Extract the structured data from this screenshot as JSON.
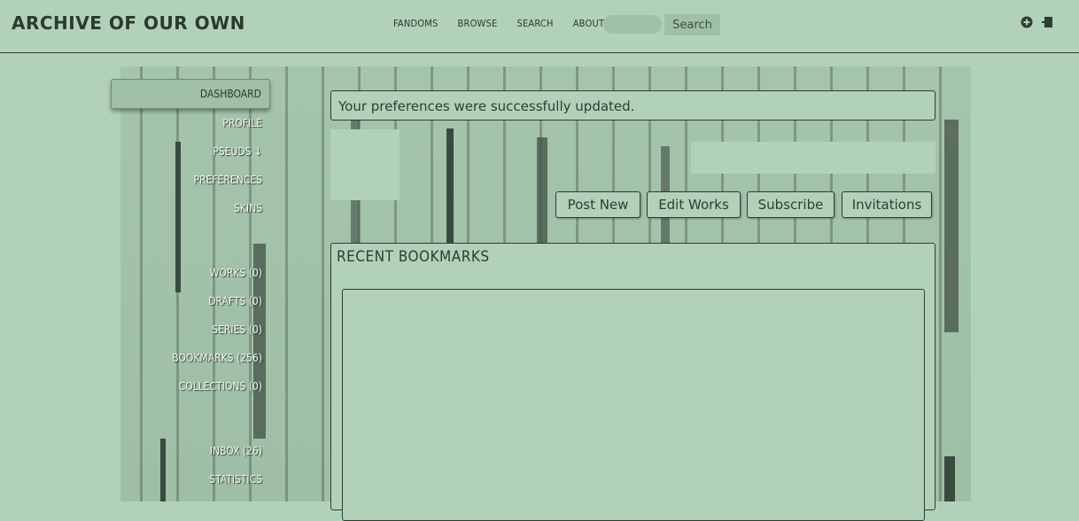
{
  "header": {
    "logo": "ARCHIVE OF OUR OWN",
    "nav": [
      "FANDOMS",
      "BROWSE",
      "SEARCH",
      "ABOUT"
    ],
    "search_button": "Search",
    "icons": [
      "plus-icon",
      "logout-icon"
    ]
  },
  "sidebar": {
    "dashboard": "DASHBOARD",
    "items": [
      {
        "label": "PROFILE"
      },
      {
        "label": "PSEUDS ↓"
      },
      {
        "label": "PREFERENCES"
      },
      {
        "label": "SKINS"
      },
      {
        "label": "WORKS (0)"
      },
      {
        "label": "DRAFTS (0)"
      },
      {
        "label": "SERIES (0)"
      },
      {
        "label": "BOOKMARKS (256)"
      },
      {
        "label": "COLLECTIONS (0)"
      },
      {
        "label": "INBOX (26)"
      },
      {
        "label": "STATISTICS"
      }
    ]
  },
  "flash": "Your preferences were successfully updated.",
  "actions": [
    "Post New",
    "Edit Works",
    "Subscribe",
    "Invitations"
  ],
  "bookmarks": {
    "heading": "RECENT BOOKMARKS"
  },
  "colors": {
    "background": "#b2d1b9",
    "text": "#2d3e32",
    "border": "#2e3d32"
  }
}
